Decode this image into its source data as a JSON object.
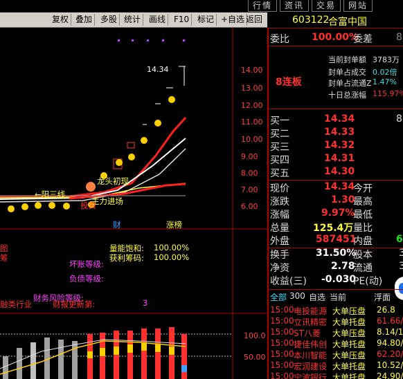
{
  "topmenu": [
    "行情",
    "资讯",
    "交易",
    "网站"
  ],
  "toolbar": [
    "复权",
    "叠加",
    "多股",
    "统计",
    "画线",
    "F10",
    "标记",
    "+自选",
    "返回"
  ],
  "ticker": {
    "code": "603122",
    "name": "合富中国"
  },
  "chart": {
    "price_labels": [
      "14.00",
      "13.00",
      "12.00",
      "11.00",
      "10.00",
      "9.00",
      "8.00",
      "7.00",
      "6.00"
    ],
    "high_label": "14.34",
    "annotations": {
      "sanyang": "←阳三线",
      "longtou": "龙头初现",
      "zhuli": "主力进场",
      "touzi": "投资",
      "cai": "财",
      "zhangbang": "涨榜"
    },
    "middle": {
      "l1": "量能饱和:",
      "v1": "100.00%",
      "l2": "获利筹码:",
      "v2": "100.00%",
      "huaizhang": "坏账等级:",
      "fuzhai": "负债等级:",
      "fengxian": "财务风险等级:",
      "hangye": "同类行业",
      "paiming": "财报更新第:",
      "paiming_val": "3",
      "left_bits": [
        "图",
        "筹",
        "",
        "",
        "",
        "融类行业"
      ]
    },
    "lower_ticks": [
      "100.0",
      "50.00"
    ]
  },
  "right": {
    "weibi_label": "委比",
    "weibi_val": "100.00%",
    "weicha_label": "委差",
    "weicha_val": "8",
    "lianban": "8连板",
    "stats": [
      {
        "label": "当前封单额",
        "value": "3783万"
      },
      {
        "label": "封单占成交",
        "value": "0.02倍"
      },
      {
        "label": "封单占流通Z",
        "value": "1.47%"
      },
      {
        "label": "十日总涨幅",
        "value": "115.97%"
      }
    ],
    "buys": [
      {
        "label": "买一",
        "price": "14.34",
        "vol": "8"
      },
      {
        "label": "买二",
        "price": "14.33",
        "vol": ""
      },
      {
        "label": "买三",
        "price": "14.32",
        "vol": ""
      },
      {
        "label": "买四",
        "price": "14.31",
        "vol": ""
      },
      {
        "label": "买五",
        "price": "14.30",
        "vol": ""
      }
    ],
    "quote": [
      {
        "l": "现价",
        "v": "14.34",
        "l2": "今开",
        "v2": ""
      },
      {
        "l": "涨跌",
        "v": "1.30",
        "l2": "最高",
        "v2": ""
      },
      {
        "l": "涨幅",
        "v": "9.97%",
        "l2": "最低",
        "v2": ""
      },
      {
        "l": "总量",
        "v": "125.4万",
        "l2": "量比",
        "v2": ""
      },
      {
        "l": "外盘",
        "v": "587451",
        "l2": "内盘",
        "v2": "6"
      }
    ],
    "quote2": [
      {
        "l": "换手",
        "v": "31.50%",
        "l2": "股本",
        "v2": "3"
      },
      {
        "l": "净资",
        "v": "2.78",
        "l2": "流通",
        "v2": "3"
      },
      {
        "l": "收益(三)",
        "v": "-0.030",
        "l2": "PE(动)",
        "v2": ""
      }
    ],
    "tabs": {
      "all": "全部",
      "n300": "300",
      "zixuan": "自选",
      "dangqian": "当前",
      "fumian": "浮面"
    },
    "list": [
      {
        "time": "15:00",
        "name": "电投能源",
        "type": "大单压盘",
        "val": "26.8"
      },
      {
        "time": "15:00",
        "name": "立讯精密",
        "type": "大单托盘",
        "val": "61.66/"
      },
      {
        "time": "15:00",
        "name": "ST八菱",
        "type": "大单压盘",
        "val": "8.14/1"
      },
      {
        "time": "15:00",
        "name": "捷佳伟创",
        "type": "大单托盘",
        "val": "94.80/"
      },
      {
        "time": "15:00",
        "name": "本川智能",
        "type": "大单压盘",
        "val": "62.20/"
      },
      {
        "time": "15:00",
        "name": "宏润建设",
        "type": "大单托盘",
        "val": "10.52/"
      },
      {
        "time": "15:00",
        "name": "宁波银行",
        "type": "大单托盘",
        "val": "24.90/"
      }
    ]
  },
  "colors": {
    "red": "#ff3030",
    "yellow": "#ffff40",
    "axis": "#aa0000",
    "green": "#20e020"
  }
}
